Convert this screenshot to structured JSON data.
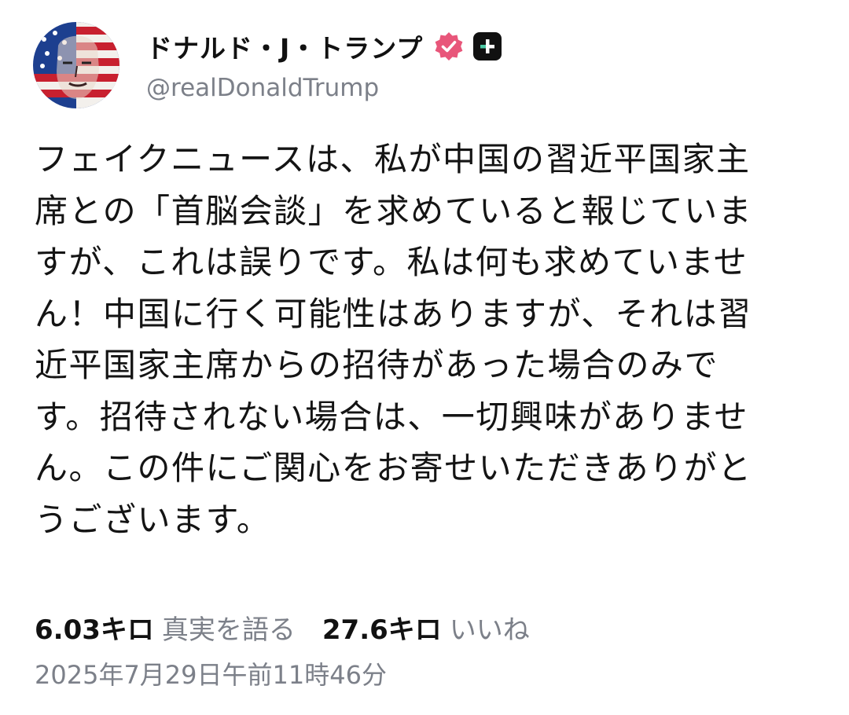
{
  "author": {
    "display_name": "ドナルド・J・トランプ",
    "handle": "@realDonaldTrump",
    "avatar_icon": "flag-portrait-avatar",
    "verified_icon": "verified-badge-icon",
    "verified_color": "#e8567a",
    "plus_icon": "plus-badge-icon"
  },
  "post": {
    "lines": [
      "フェイクニュースは、私が中国の習近平国家主",
      "席との「首脳会談」を求めていると報じていま",
      "すが、これは誤りです。私は何も求めていませ",
      "ん！中国に行く可能性はありますが、それは習",
      "近平国家主席からの招待があった場合のみで",
      "す。招待されない場合は、一切興味がありませ",
      "ん。この件にご関心をお寄せいただきありがと",
      "うございます。"
    ]
  },
  "stats": {
    "retruths_count": "6.03キロ",
    "retruths_label": "真実を語る",
    "likes_count": "27.6キロ",
    "likes_label": "いいね"
  },
  "timestamp": "2025年7月29日午前11時46分",
  "colors": {
    "text": "#141414",
    "muted": "#7c8089",
    "badge_dark": "#111111"
  }
}
